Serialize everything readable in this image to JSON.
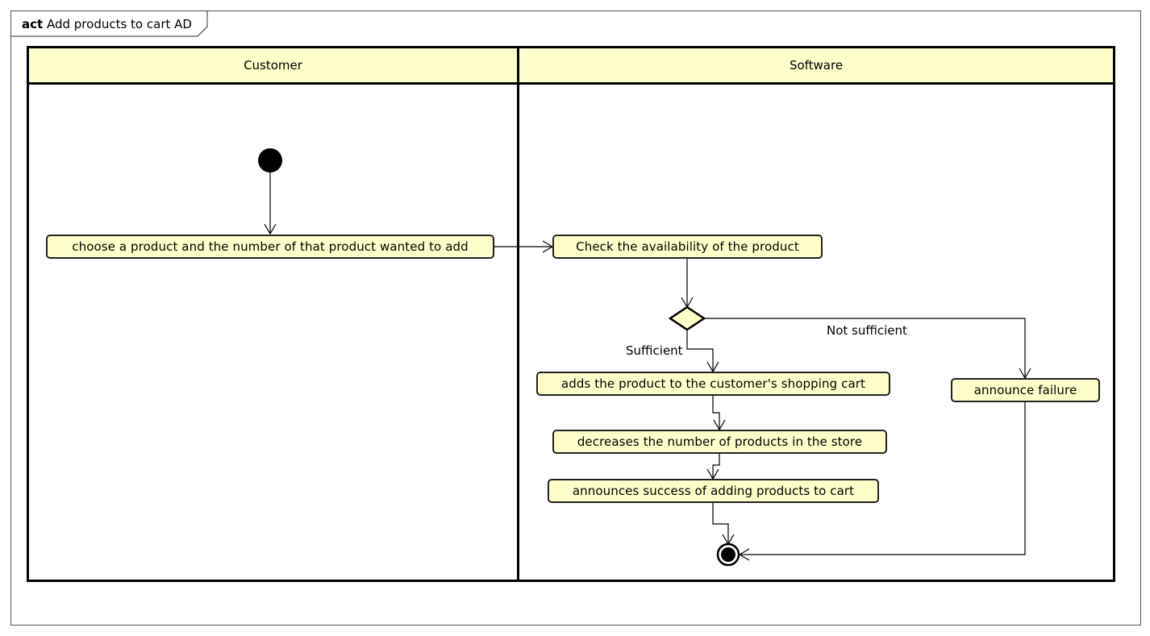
{
  "frame": {
    "keyword": "act",
    "title": "Add products to cart AD"
  },
  "lanes": [
    {
      "label": "Customer"
    },
    {
      "label": "Software"
    }
  ],
  "actions": {
    "choose_product": "choose a product and the number of that product wanted to add",
    "check_availability": "Check the availability of the product",
    "add_to_cart": "adds the product to the customer's shopping cart",
    "decrease_stock": "decreases the number of products in the store",
    "announce_success": "announces success of adding products to cart",
    "announce_failure": "announce failure"
  },
  "guards": {
    "sufficient": "Sufficient",
    "not_sufficient": "Not sufficient"
  },
  "colors": {
    "node_fill": "#FFFFCC",
    "stroke": "#000000"
  }
}
